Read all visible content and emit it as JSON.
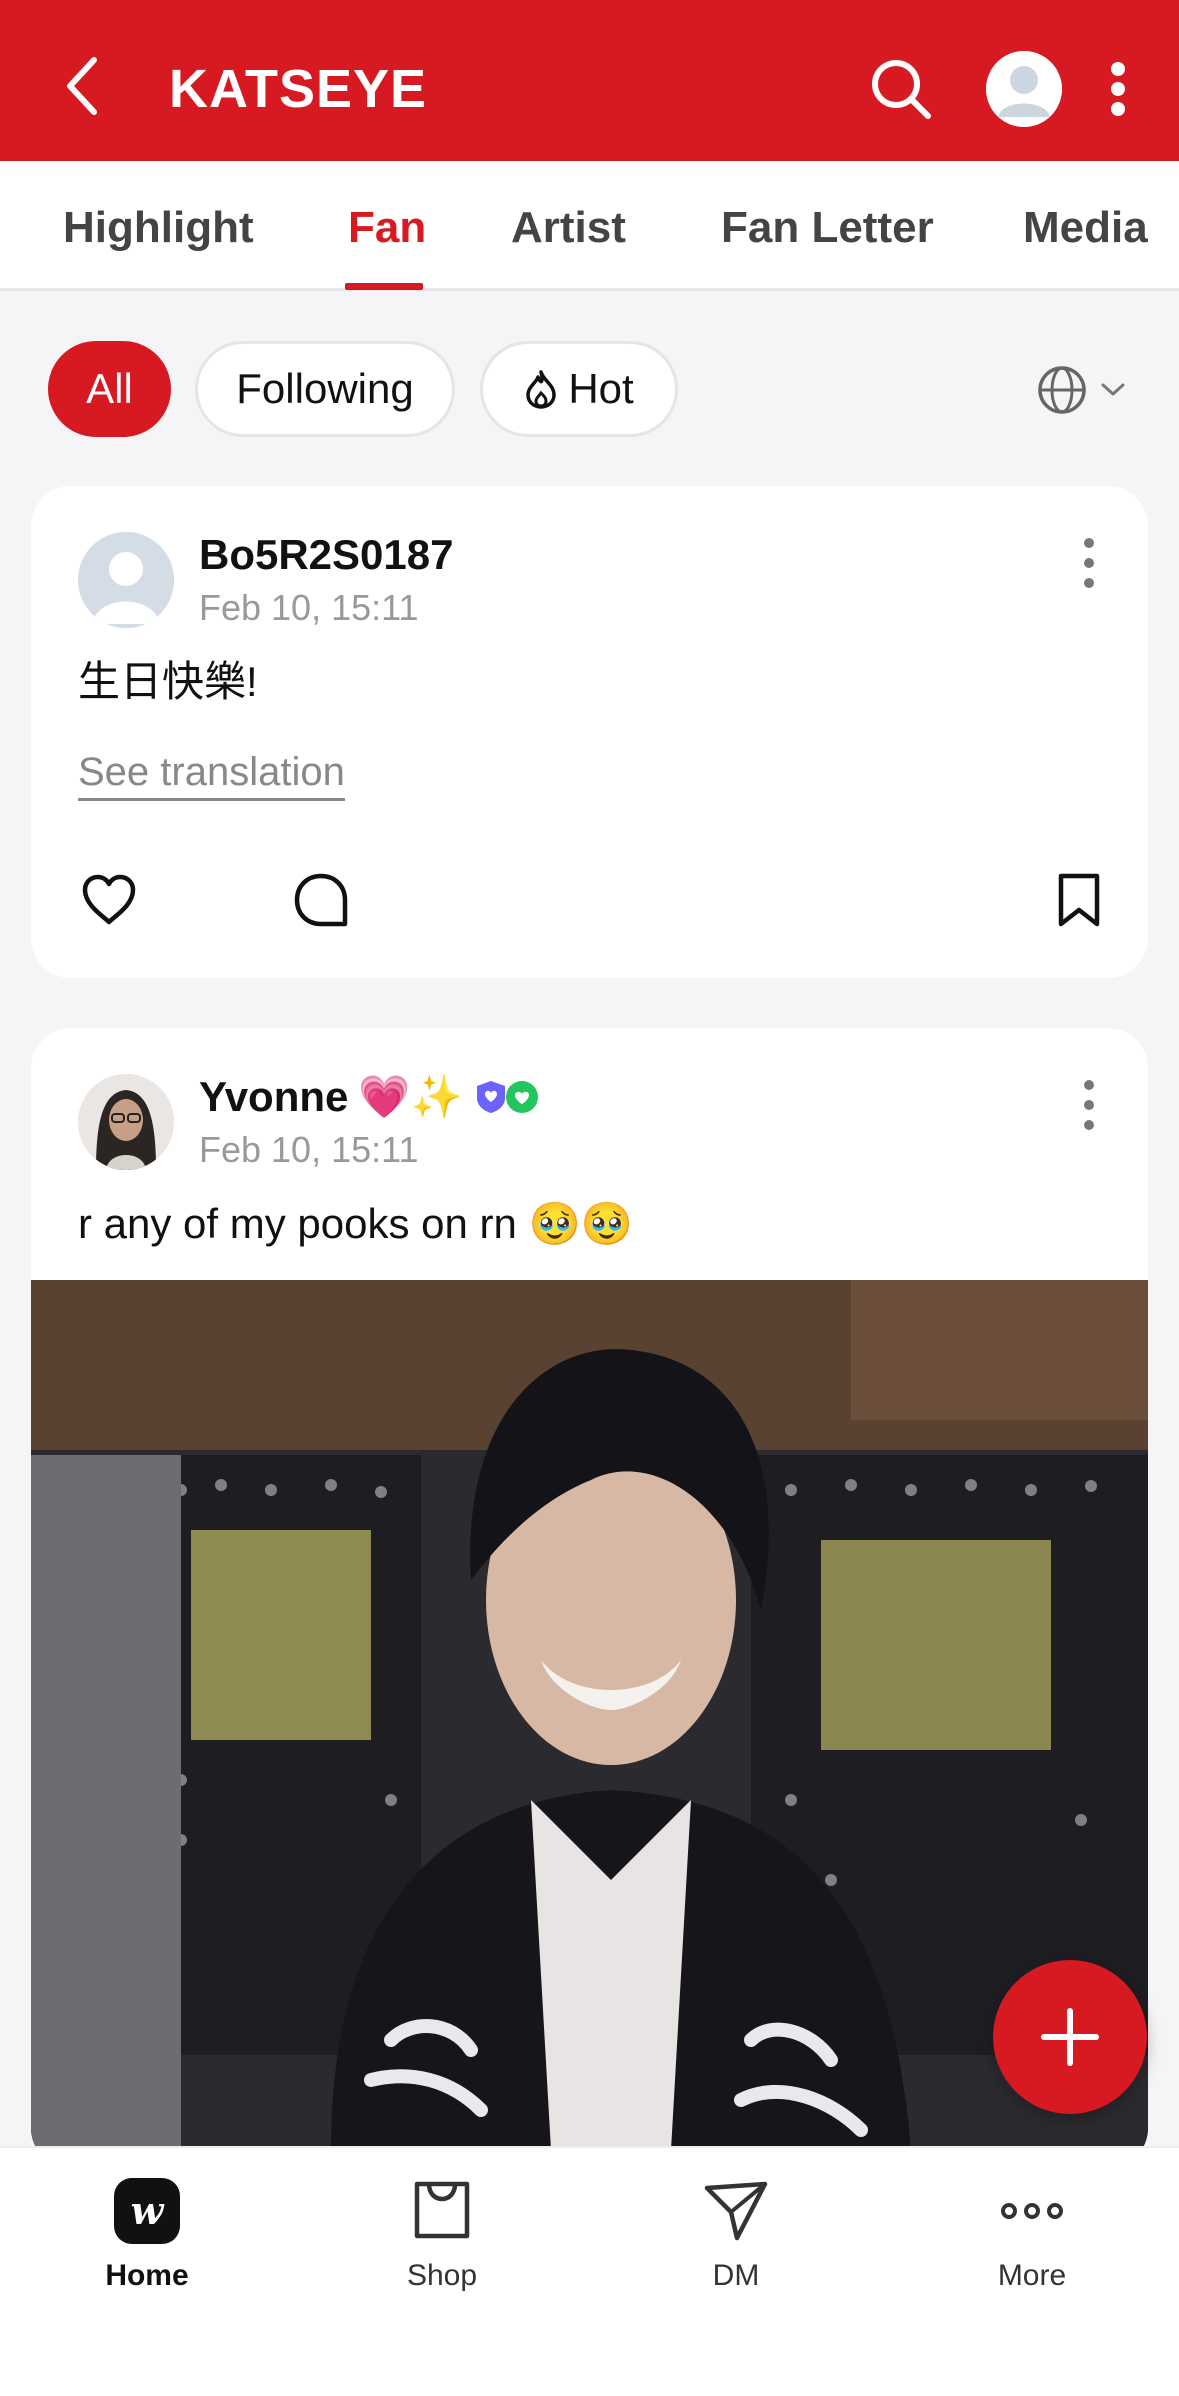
{
  "header": {
    "title": "KATSEYE",
    "back_icon": "chevron-left-icon",
    "search_icon": "search-icon",
    "profile_icon": "avatar",
    "menu_icon": "more-vertical-icon",
    "bg_color": "#d71921"
  },
  "tabs": [
    {
      "label": "Highlight"
    },
    {
      "label": "Fan"
    },
    {
      "label": "Artist"
    },
    {
      "label": "Fan Letter"
    },
    {
      "label": "Media"
    }
  ],
  "active_tab": "Fan",
  "filters": {
    "all": "All",
    "following": "Following",
    "hot": "Hot",
    "language_icon": "globe-icon"
  },
  "posts": [
    {
      "author": "Bo5R2S0187",
      "time": "Feb 10, 15:11",
      "text": "生日快樂!",
      "see_translation": "See translation"
    },
    {
      "author": "Yvonne",
      "author_emojis": "💗✨",
      "time": "Feb 10, 15:11",
      "text": "r any of my pooks on rn 🥹🥹"
    }
  ],
  "bottom_nav": [
    {
      "label": "Home",
      "icon": "weverse-home-icon"
    },
    {
      "label": "Shop",
      "icon": "shopping-bag-icon"
    },
    {
      "label": "DM",
      "icon": "paper-plane-icon"
    },
    {
      "label": "More",
      "icon": "more-horizontal-icon"
    }
  ],
  "active_nav": "Home"
}
